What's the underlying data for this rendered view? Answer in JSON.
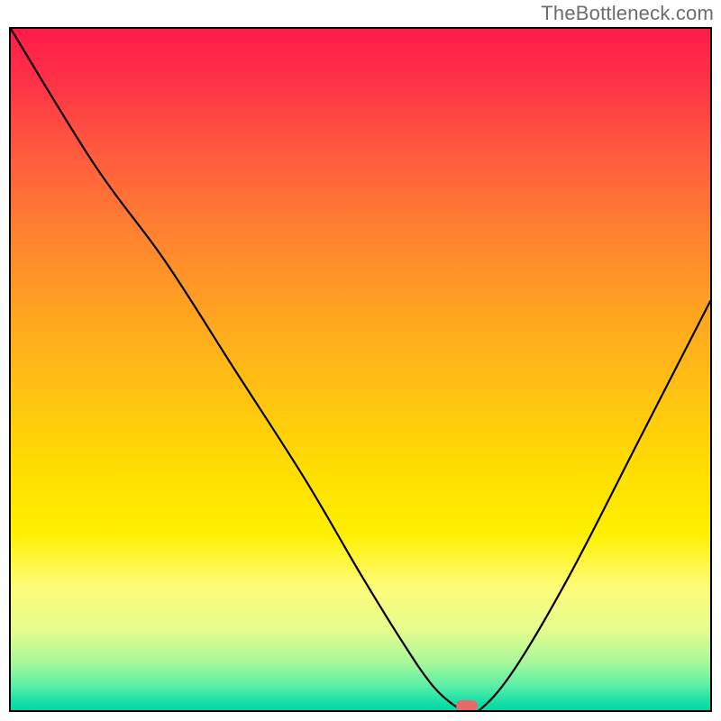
{
  "watermark": "TheBottleneck.com",
  "chart_data": {
    "type": "line",
    "title": "",
    "xlabel": "",
    "ylabel": "",
    "xlim": [
      0,
      100
    ],
    "ylim": [
      0,
      100
    ],
    "grid": false,
    "series": [
      {
        "name": "bottleneck-curve",
        "x": [
          0,
          12,
          22,
          32,
          42,
          50,
          56,
          60,
          63,
          65,
          67,
          72,
          80,
          90,
          100
        ],
        "values": [
          100,
          80,
          66,
          50,
          34,
          20,
          10,
          4,
          1,
          0,
          0,
          6,
          20,
          40,
          60
        ]
      }
    ],
    "annotations": [
      {
        "name": "optimal-marker",
        "x": 65.2,
        "y": 0.7,
        "color": "#e76a6a"
      }
    ],
    "background": "vertical-gradient red→orange→yellow→green"
  }
}
